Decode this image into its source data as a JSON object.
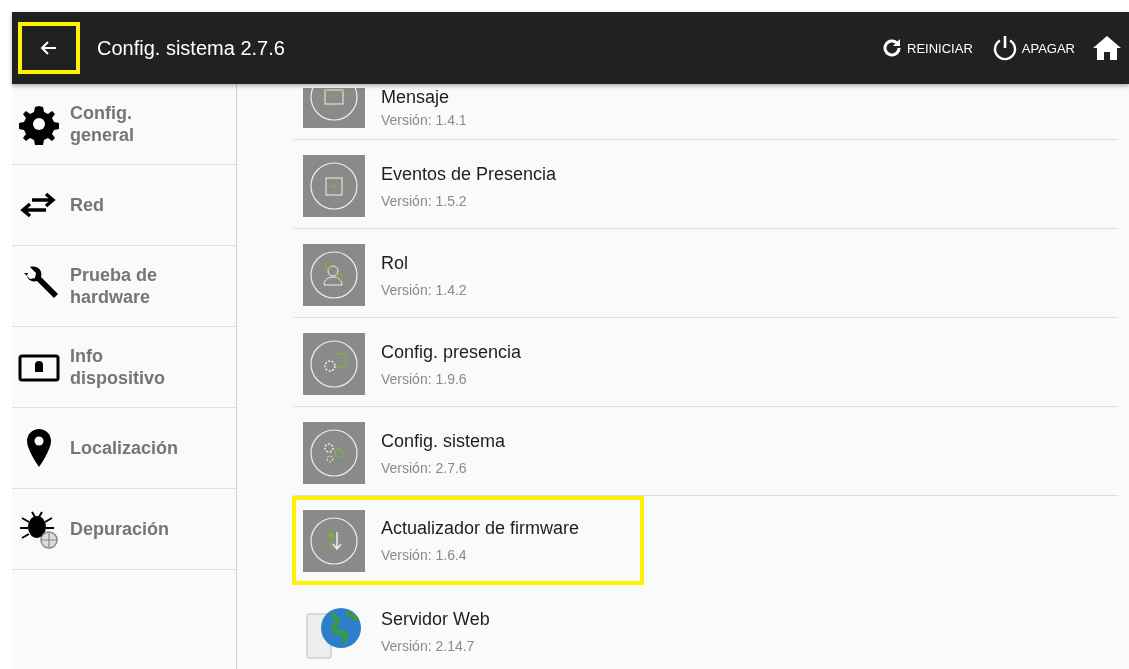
{
  "header": {
    "back_highlighted": true,
    "title": "Config. sistema 2.7.6",
    "actions": [
      {
        "kind": "restart",
        "label": "REINICIAR"
      },
      {
        "kind": "power",
        "label": "APAGAR"
      },
      {
        "kind": "home"
      }
    ]
  },
  "sidebar": {
    "items": [
      {
        "kind": "gear",
        "label": "Config. general"
      },
      {
        "kind": "arrows",
        "label": "Red"
      },
      {
        "kind": "wrench",
        "label": "Prueba de hardware"
      },
      {
        "kind": "tablet",
        "label": "Info dispositivo"
      },
      {
        "kind": "pin",
        "label": "Localización"
      },
      {
        "kind": "bug",
        "label": "Depuración"
      }
    ]
  },
  "apps": [
    {
      "kind": "message",
      "name": "Mensaje",
      "version": "Versión: 1.4.1",
      "highlighted": false
    },
    {
      "kind": "calendar",
      "name": "Eventos de Presencia",
      "version": "Versión: 1.5.2",
      "highlighted": false
    },
    {
      "kind": "role",
      "name": "Rol",
      "version": "Versión: 1.4.2",
      "highlighted": false
    },
    {
      "kind": "presence",
      "name": "Config. presencia",
      "version": "Versión: 1.9.6",
      "highlighted": false
    },
    {
      "kind": "system",
      "name": "Config. sistema",
      "version": "Versión: 2.7.6",
      "highlighted": false
    },
    {
      "kind": "firmware",
      "name": "Actualizador de firmware",
      "version": "Versión: 1.6.4",
      "highlighted": true
    },
    {
      "kind": "web",
      "name": "Servidor Web",
      "version": "Versión: 2.14.7",
      "highlighted": false
    }
  ]
}
